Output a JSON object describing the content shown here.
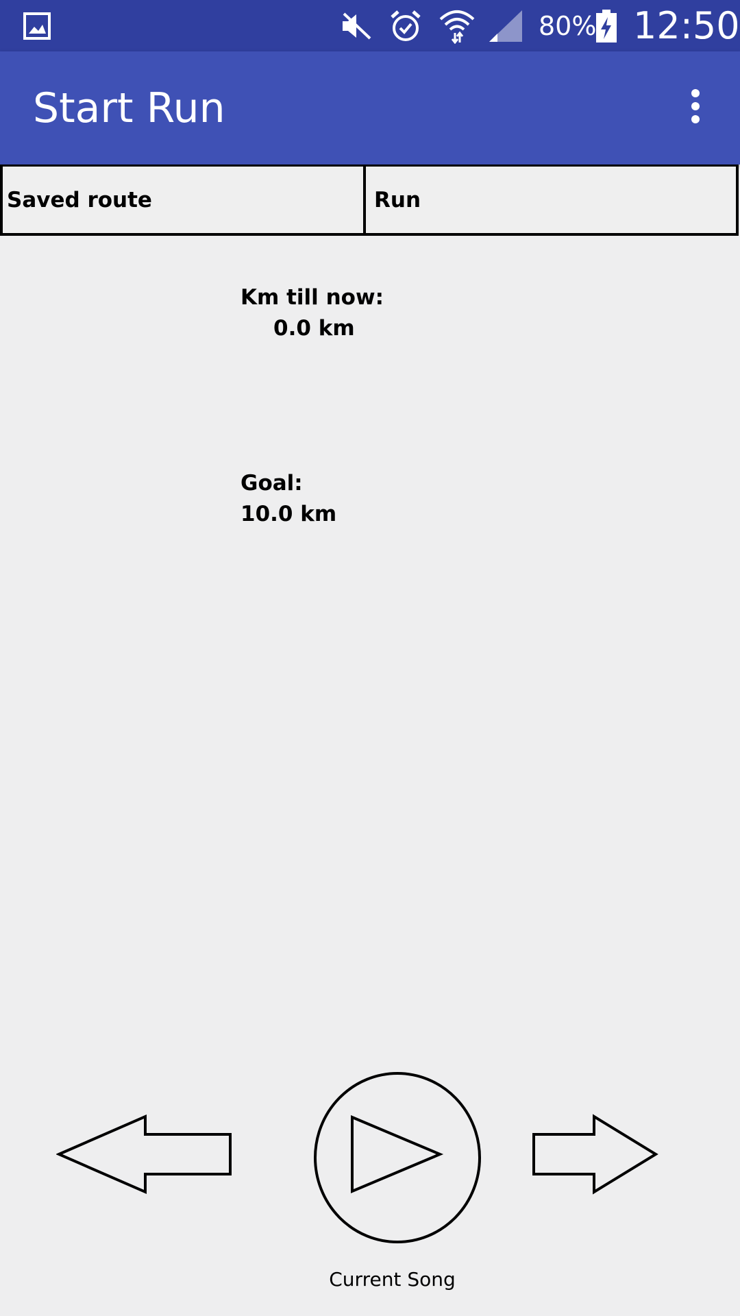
{
  "status_bar": {
    "icons": [
      "gallery-icon",
      "mute-icon",
      "alarm-icon",
      "wifi-icon",
      "signal-icon",
      "battery-charging-icon"
    ],
    "battery": "80%",
    "clock": "12:50",
    "color": "#303f9f"
  },
  "app_bar": {
    "title": "Start Run",
    "menu_icon": "more-vert-icon",
    "color": "#3f51b5"
  },
  "tabs": [
    {
      "label": "Saved route"
    },
    {
      "label": "Run"
    }
  ],
  "stats": {
    "km_label": "Km till now:",
    "km_value": "0.0 km",
    "goal_label": "Goal:",
    "goal_value": "10.0 km"
  },
  "player": {
    "prev_icon": "arrow-left-icon",
    "play_icon": "play-icon",
    "next_icon": "arrow-right-icon",
    "current_song": "Current Song"
  }
}
